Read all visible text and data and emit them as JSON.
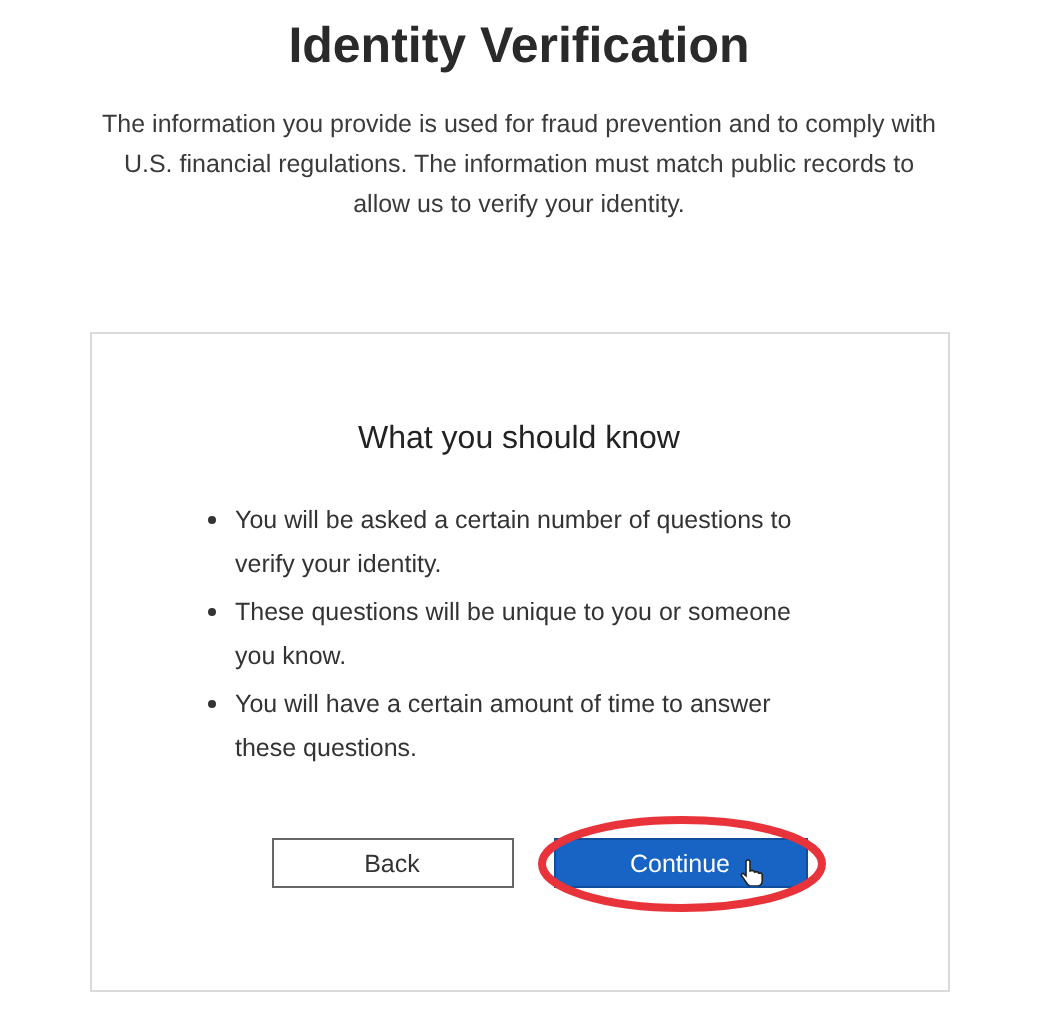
{
  "title": "Identity Verification",
  "intro": "The information you provide is used for fraud prevention and to comply with U.S. financial regulations. The information must match public records to allow us to verify your identity.",
  "card": {
    "heading": "What you should know",
    "bullets": [
      "You will be asked a certain number of questions to verify your identity.",
      "These questions will be unique to you or someone you know.",
      "You will have a certain amount of time to answer these questions."
    ],
    "buttons": [
      {
        "label": "Back",
        "kind": "secondary",
        "highlighted": false
      },
      {
        "label": "Continue",
        "kind": "primary",
        "highlighted": true
      }
    ]
  }
}
